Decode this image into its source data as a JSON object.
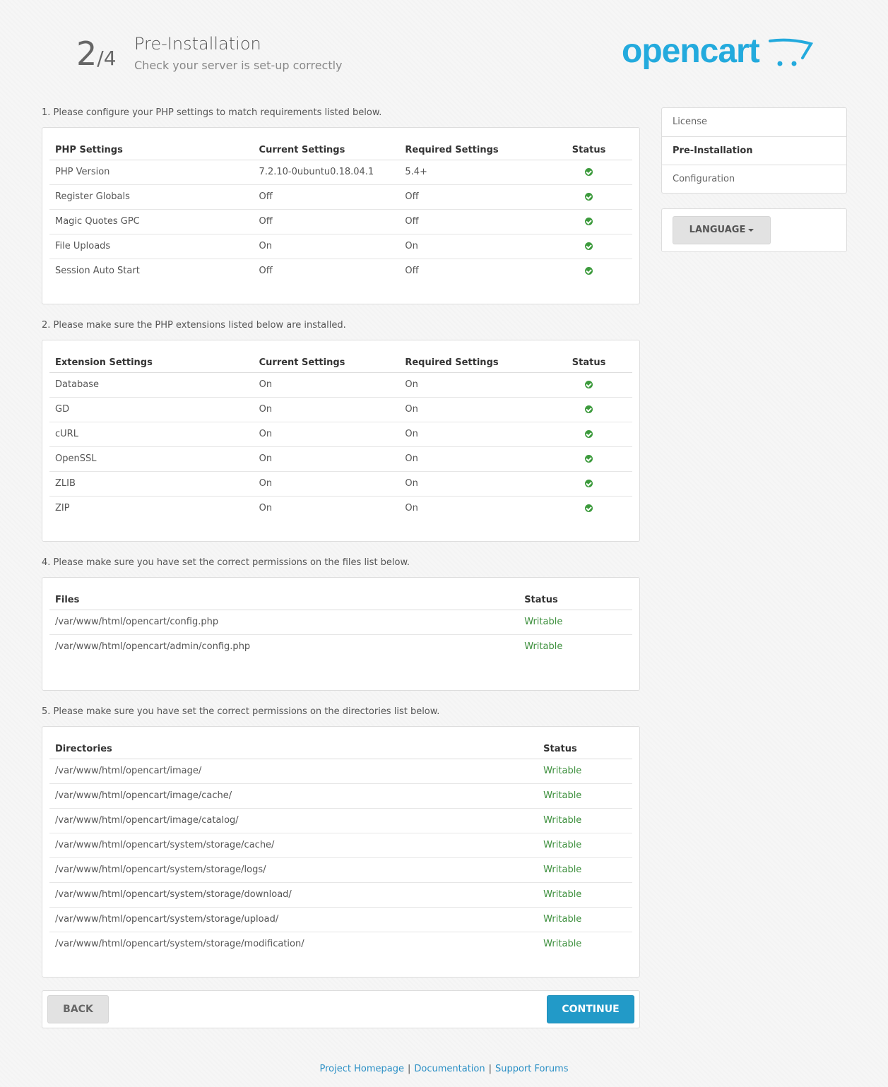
{
  "header": {
    "step_current": "2",
    "step_total": "/4",
    "title": "Pre-Installation",
    "subtitle": "Check your server is set-up correctly",
    "logo_text": "opencart",
    "logo_color": "#23aadd"
  },
  "sections": {
    "php": {
      "label": "1. Please configure your PHP settings to match requirements listed below.",
      "headers": [
        "PHP Settings",
        "Current Settings",
        "Required Settings",
        "Status"
      ],
      "rows": [
        {
          "name": "PHP Version",
          "current": "7.2.10-0ubuntu0.18.04.1",
          "required": "5.4+"
        },
        {
          "name": "Register Globals",
          "current": "Off",
          "required": "Off"
        },
        {
          "name": "Magic Quotes GPC",
          "current": "Off",
          "required": "Off"
        },
        {
          "name": "File Uploads",
          "current": "On",
          "required": "On"
        },
        {
          "name": "Session Auto Start",
          "current": "Off",
          "required": "Off"
        }
      ]
    },
    "extensions": {
      "label": "2. Please make sure the PHP extensions listed below are installed.",
      "headers": [
        "Extension Settings",
        "Current Settings",
        "Required Settings",
        "Status"
      ],
      "rows": [
        {
          "name": "Database",
          "current": "On",
          "required": "On"
        },
        {
          "name": "GD",
          "current": "On",
          "required": "On"
        },
        {
          "name": "cURL",
          "current": "On",
          "required": "On"
        },
        {
          "name": "OpenSSL",
          "current": "On",
          "required": "On"
        },
        {
          "name": "ZLIB",
          "current": "On",
          "required": "On"
        },
        {
          "name": "ZIP",
          "current": "On",
          "required": "On"
        }
      ]
    },
    "files": {
      "label": "4. Please make sure you have set the correct permissions on the files list below.",
      "headers": [
        "Files",
        "Status"
      ],
      "rows": [
        {
          "path": "/var/www/html/opencart/config.php",
          "status": "Writable"
        },
        {
          "path": "/var/www/html/opencart/admin/config.php",
          "status": "Writable"
        }
      ]
    },
    "directories": {
      "label": "5. Please make sure you have set the correct permissions on the directories list below.",
      "headers": [
        "Directories",
        "Status"
      ],
      "rows": [
        {
          "path": "/var/www/html/opencart/image/",
          "status": "Writable"
        },
        {
          "path": "/var/www/html/opencart/image/cache/",
          "status": "Writable"
        },
        {
          "path": "/var/www/html/opencart/image/catalog/",
          "status": "Writable"
        },
        {
          "path": "/var/www/html/opencart/system/storage/cache/",
          "status": "Writable"
        },
        {
          "path": "/var/www/html/opencart/system/storage/logs/",
          "status": "Writable"
        },
        {
          "path": "/var/www/html/opencart/system/storage/download/",
          "status": "Writable"
        },
        {
          "path": "/var/www/html/opencart/system/storage/upload/",
          "status": "Writable"
        },
        {
          "path": "/var/www/html/opencart/system/storage/modification/",
          "status": "Writable"
        }
      ]
    }
  },
  "sidebar": {
    "nav": [
      {
        "label": "License",
        "active": false
      },
      {
        "label": "Pre-Installation",
        "active": true
      },
      {
        "label": "Configuration",
        "active": false
      }
    ],
    "language_button": "LANGUAGE"
  },
  "buttons": {
    "back": "BACK",
    "continue": "CONTINUE"
  },
  "footer": {
    "links": [
      "Project Homepage",
      "Documentation",
      "Support Forums"
    ],
    "separator": "|"
  },
  "icons": {
    "status_ok": "check-circle-icon",
    "caret": "caret-down-icon"
  },
  "colors": {
    "ok_green": "#3c9a3c",
    "primary_blue": "#229ac8",
    "link_blue": "#2a8fc5"
  }
}
